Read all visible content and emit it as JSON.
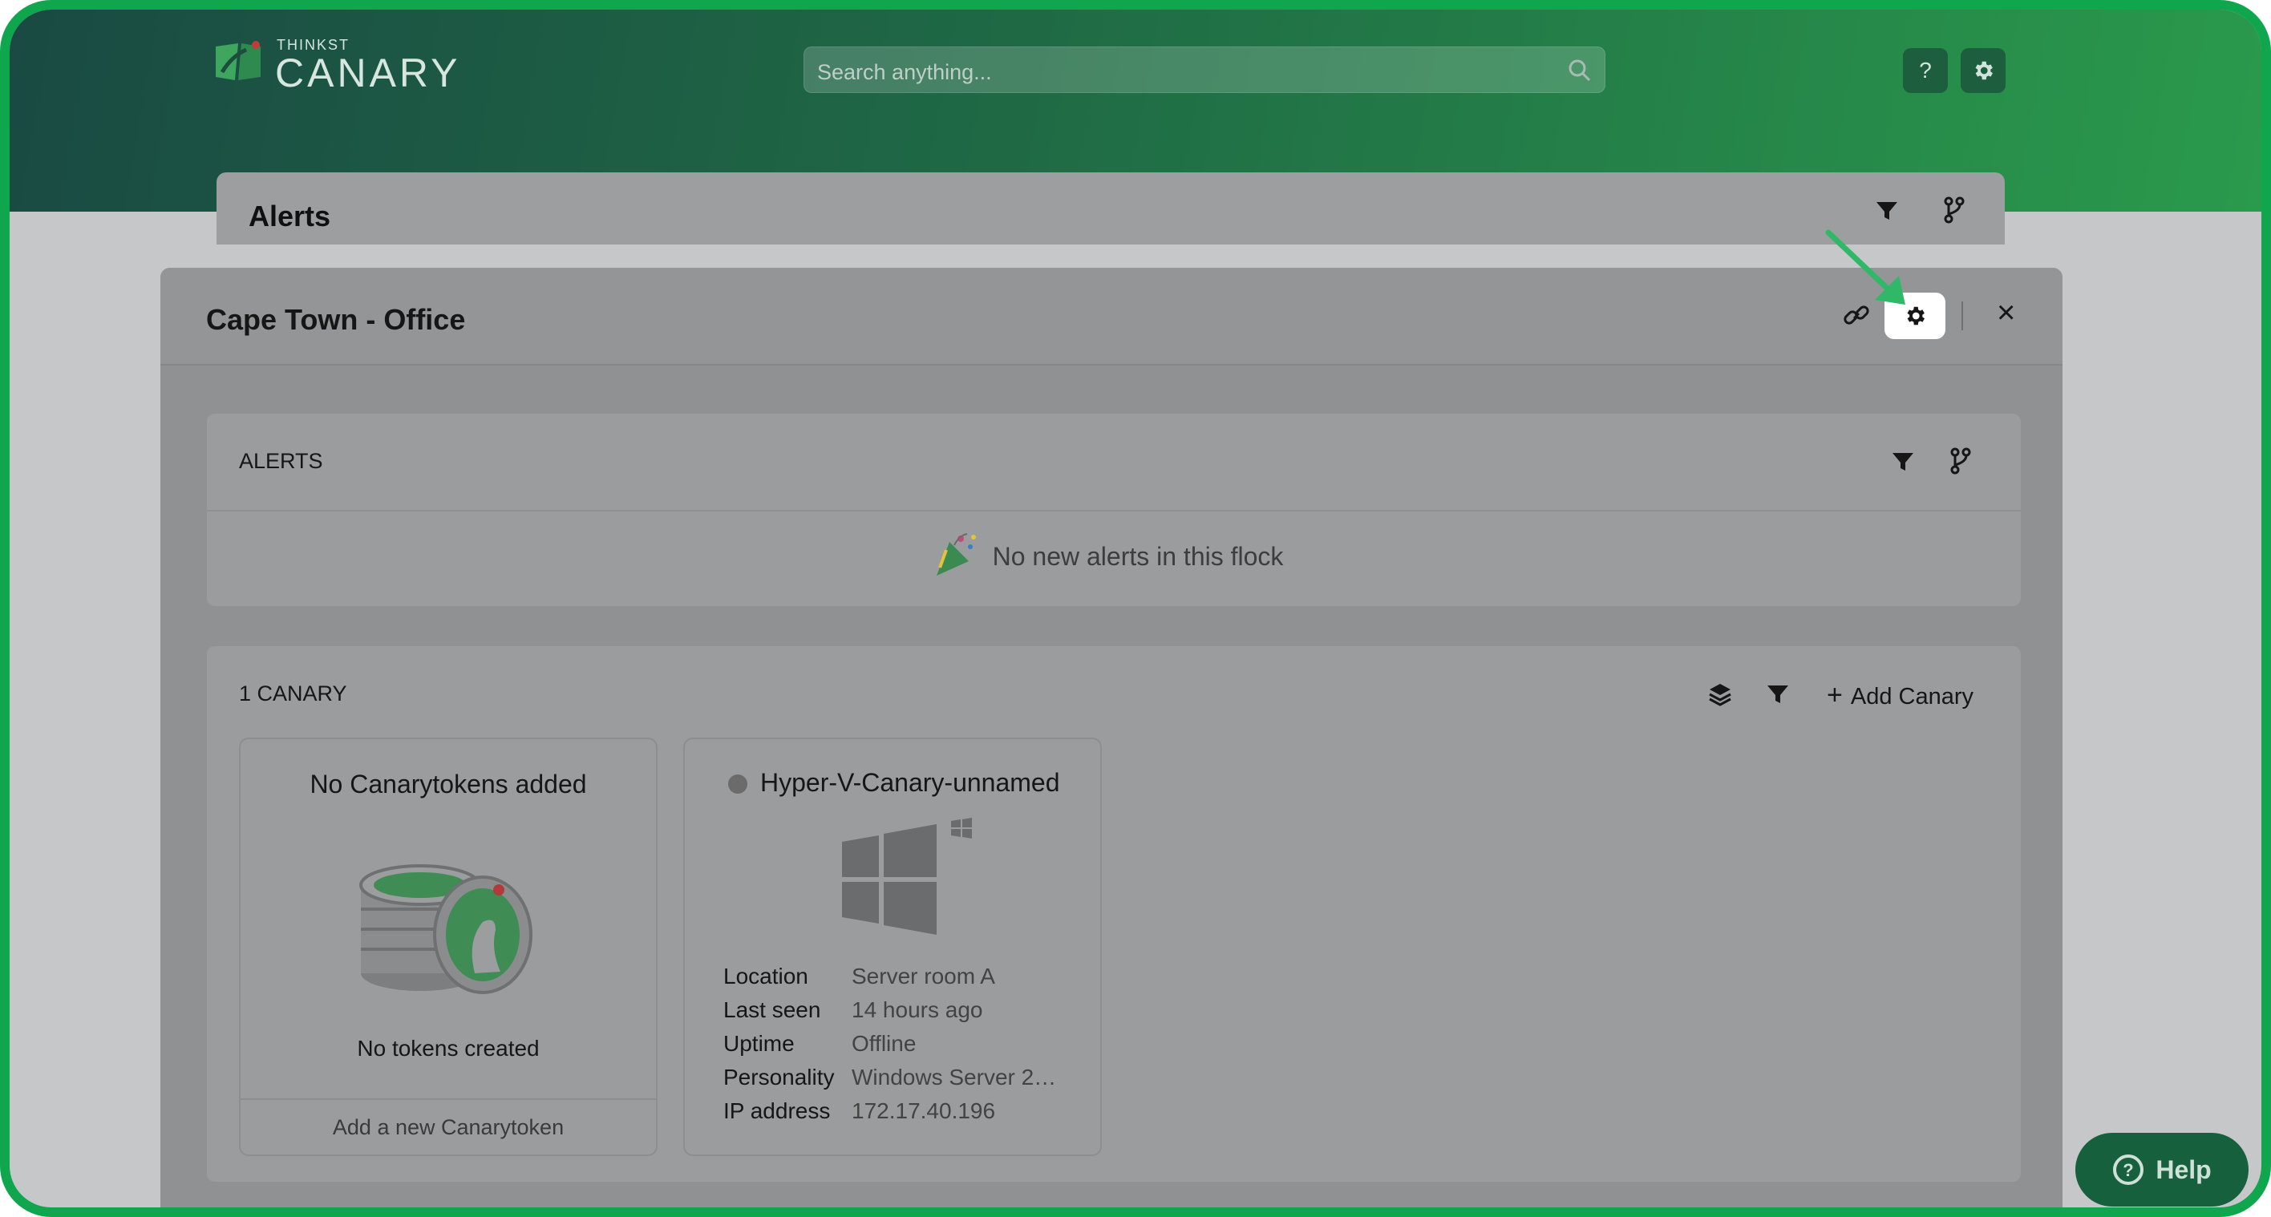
{
  "brand": {
    "small": "THINKST",
    "name": "CANARY"
  },
  "search": {
    "placeholder": "Search anything..."
  },
  "topbar": {
    "help_label": "?"
  },
  "background_panel": {
    "title": "Alerts"
  },
  "modal": {
    "title": "Cape Town - Office",
    "close_label": "×"
  },
  "alerts_section": {
    "label": "ALERTS",
    "empty_message": "No new alerts in this flock"
  },
  "canary_section": {
    "label": "1 CANARY",
    "add_label": "Add Canary"
  },
  "tokens_tile": {
    "title": "No Canarytokens added",
    "subtitle": "No tokens created",
    "footer": "Add a new Canarytoken"
  },
  "device_tile": {
    "name": "Hyper-V-Canary-unnamed",
    "status_color": "#6b6b6b",
    "details": [
      {
        "key": "Location",
        "value": "Server room A"
      },
      {
        "key": "Last seen",
        "value": "14 hours ago"
      },
      {
        "key": "Uptime",
        "value": "Offline"
      },
      {
        "key": "Personality",
        "value": "Windows Server 2…"
      },
      {
        "key": "IP address",
        "value": "172.17.40.196"
      }
    ]
  },
  "help_button": {
    "label": "Help"
  },
  "colors": {
    "accent": "#0fa64e",
    "brand_dark": "#1a4a43",
    "highlight_arrow": "#2fb867"
  }
}
